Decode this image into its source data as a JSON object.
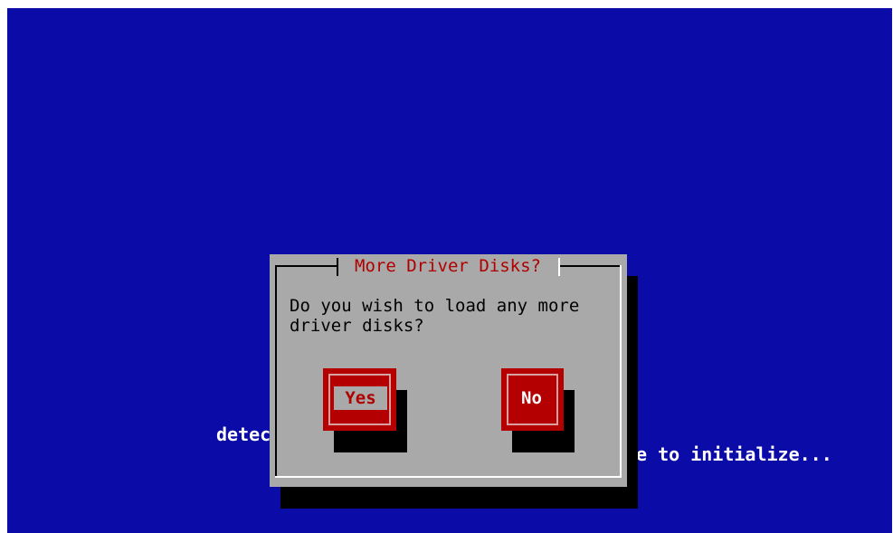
{
  "background": {
    "color": "#0b0ba8",
    "text_left": "detec",
    "text_right": "e to initialize..."
  },
  "dialog": {
    "title": "More Driver Disks?",
    "message_line1": "Do you wish to load any more",
    "message_line2": "driver disks?",
    "title_color": "#b00000",
    "panel_color": "#a9a9a9"
  },
  "buttons": {
    "yes_label": "Yes",
    "no_label": "No",
    "accent_color": "#b40000"
  }
}
